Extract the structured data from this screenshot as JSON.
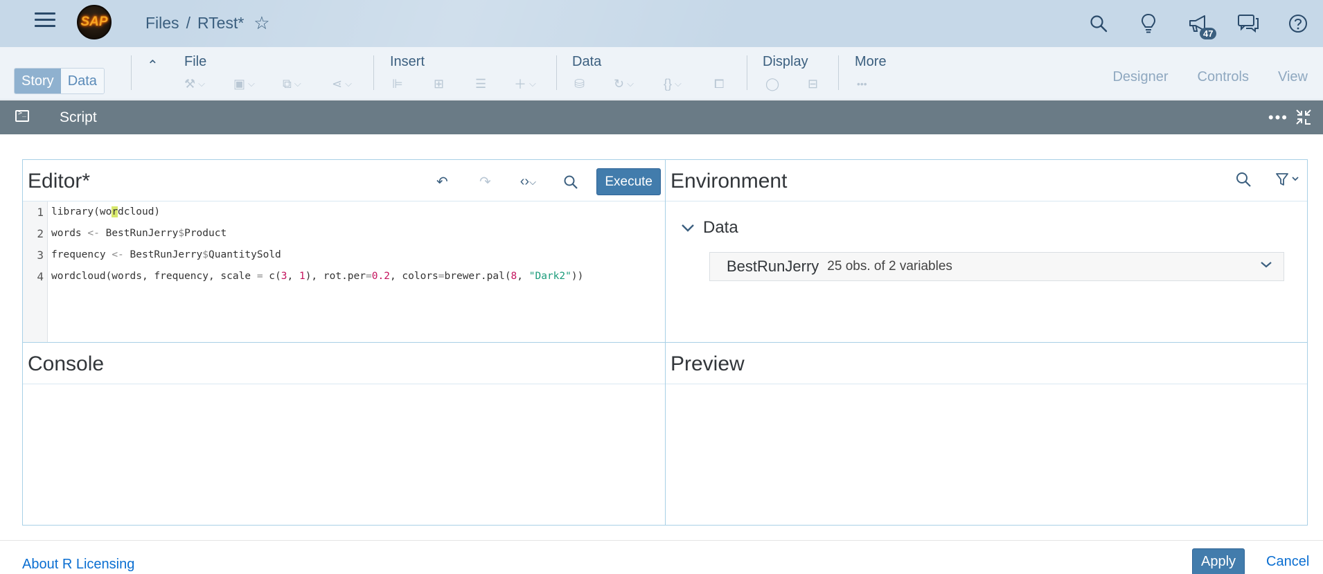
{
  "shell": {
    "logo_text": "SAP",
    "breadcrumb_root": "Files",
    "breadcrumb_sep": "/",
    "breadcrumb_current": "RTest*",
    "notification_count": "47",
    "icons": [
      "search-icon",
      "lightbulb-icon",
      "megaphone-icon",
      "chat-icon",
      "help-icon"
    ]
  },
  "toolbar": {
    "segments": [
      "Story",
      "Data"
    ],
    "active_segment": "Story",
    "groups": {
      "file": "File",
      "insert": "Insert",
      "data": "Data",
      "display": "Display",
      "more": "More"
    },
    "modes": [
      "Designer",
      "Controls",
      "View"
    ]
  },
  "script_bar": {
    "title": "Script",
    "more": "•••"
  },
  "editor": {
    "title": "Editor*",
    "execute_label": "Execute",
    "line_numbers": [
      "1",
      "2",
      "3",
      "4"
    ],
    "lines": {
      "l1a": "library(wo",
      "l1b": "r",
      "l1c": "dcloud)",
      "l2a": "words ",
      "l2op": "<-",
      "l2b": " BestRunJerry",
      "l2d": "$",
      "l2c": "Product",
      "l3a": "frequency ",
      "l3op": "<-",
      "l3b": " BestRunJerry",
      "l3d": "$",
      "l3c": "QuantitySold",
      "l4a": "wordcloud(words, frequency, scale ",
      "l4eq": "=",
      "l4b": " c(",
      "l4n1": "3",
      "l4c": ", ",
      "l4n2": "1",
      "l4d": "), rot.per",
      "l4eq2": "=",
      "l4n3": "0.2",
      "l4e": ", colors",
      "l4eq3": "=",
      "l4f": "brewer.pal(",
      "l4n4": "8",
      "l4g": ", ",
      "l4s": "\"Dark2\"",
      "l4h": "))"
    }
  },
  "environment": {
    "title": "Environment",
    "node_label": "Data",
    "variable_name": "BestRunJerry",
    "variable_desc": "25 obs. of 2 variables"
  },
  "console": {
    "title": "Console"
  },
  "preview": {
    "title": "Preview"
  },
  "footer": {
    "license_link": "About R Licensing",
    "apply_label": "Apply",
    "cancel_label": "Cancel"
  },
  "colors": {
    "shell_bg": "#c6d8e8",
    "accent": "#427cac",
    "link": "#0a6ed1",
    "script_bar": "#6a7b86"
  }
}
